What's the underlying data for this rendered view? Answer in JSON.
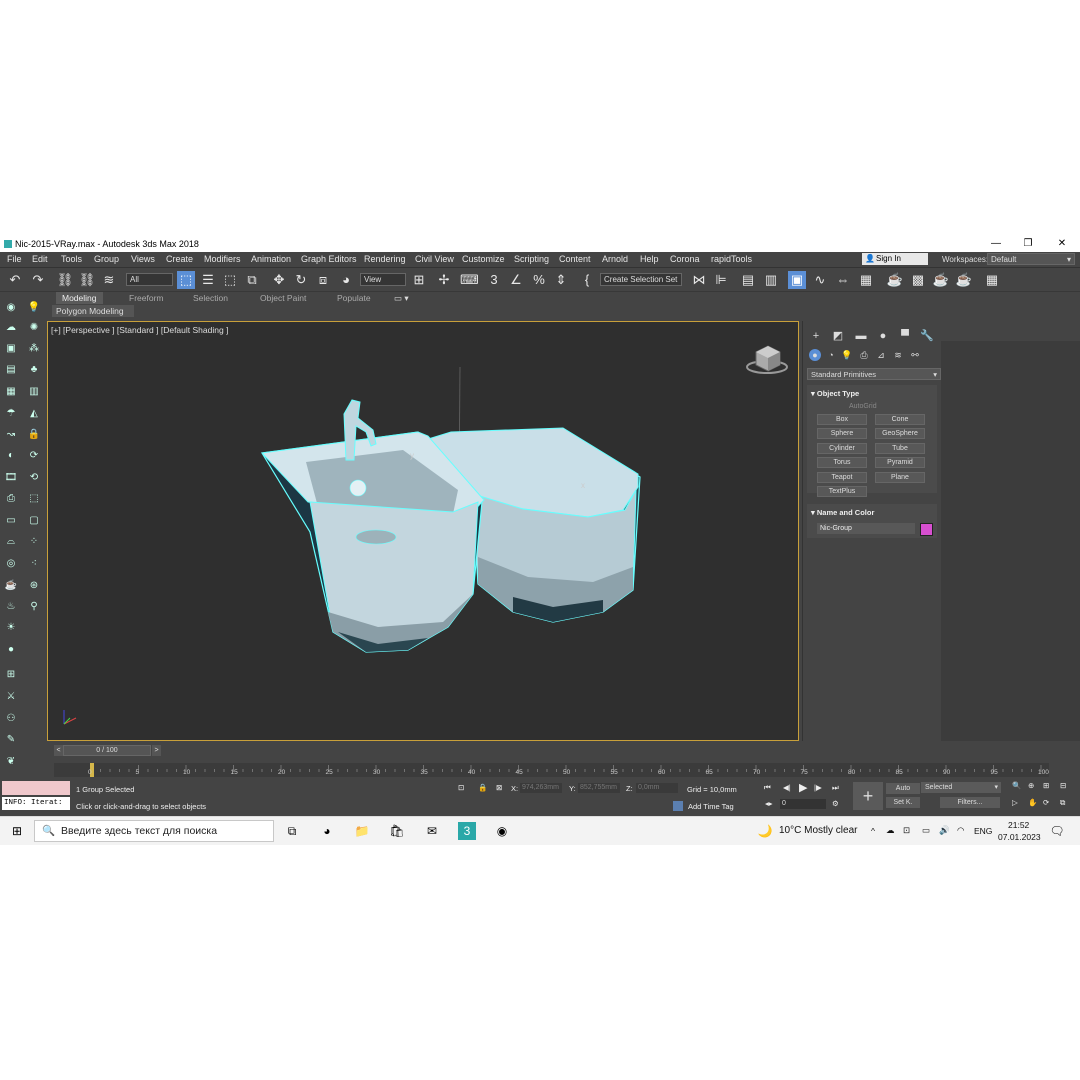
{
  "window": {
    "title": "Nic-2015-VRay.max - Autodesk 3ds Max 2018",
    "controls": [
      "—",
      "❐",
      "✕"
    ]
  },
  "menu": [
    "File",
    "Edit",
    "Tools",
    "Group",
    "Views",
    "Create",
    "Modifiers",
    "Animation",
    "Graph Editors",
    "Rendering",
    "Civil View",
    "Customize",
    "Scripting",
    "Content",
    "Arnold",
    "Help",
    "Corona",
    "rapidTools"
  ],
  "account": {
    "signin": "Sign In",
    "workspaces_label": "Workspaces:",
    "workspace": "Default"
  },
  "toolbar": {
    "filter": "All",
    "ref_coord": "View",
    "selection_set": "Create Selection Set"
  },
  "ribbon": {
    "tabs": [
      "Modeling",
      "Freeform",
      "Selection",
      "Object Paint",
      "Populate"
    ],
    "active": "Modeling",
    "panel": "Polygon Modeling"
  },
  "viewport": {
    "label": "[+] [Perspective ] [Standard ] [Default Shading ]"
  },
  "command_panel": {
    "dropdown": "Standard Primitives",
    "object_type": {
      "title": "Object Type",
      "autogrid": "AutoGrid",
      "buttons": [
        "Box",
        "Cone",
        "Sphere",
        "GeoSphere",
        "Cylinder",
        "Tube",
        "Torus",
        "Pyramid",
        "Teapot",
        "Plane",
        "TextPlus"
      ]
    },
    "name_color": {
      "title": "Name and Color",
      "name": "Nic-Group",
      "color": "#d74fd0"
    }
  },
  "timeline": {
    "slider": "0 / 100",
    "ticks": [
      "0",
      "5",
      "10",
      "15",
      "20",
      "25",
      "30",
      "35",
      "40",
      "45",
      "50",
      "55",
      "60",
      "65",
      "70",
      "75",
      "80",
      "85",
      "90",
      "95",
      "100"
    ]
  },
  "status": {
    "info": "INFO: Iterat:",
    "selected": "1 Group Selected",
    "prompt": "Click or click-and-drag to select objects",
    "x_label": "X:",
    "x": "974,263mm",
    "y_label": "Y:",
    "y": "852,755mm",
    "z_label": "Z:",
    "z": "0,0mm",
    "grid": "Grid = 10,0mm",
    "add_time_tag": "Add Time Tag",
    "auto": "Auto",
    "selected_dropdown": "Selected",
    "set_key": "Set K.",
    "filters": "Filters...",
    "frame": "0"
  },
  "taskbar": {
    "search_placeholder": "Введите здесь текст для поиска",
    "weather": "10°C  Mostly clear",
    "lang": "ENG",
    "time": "21:52",
    "date": "07.01.2023"
  }
}
